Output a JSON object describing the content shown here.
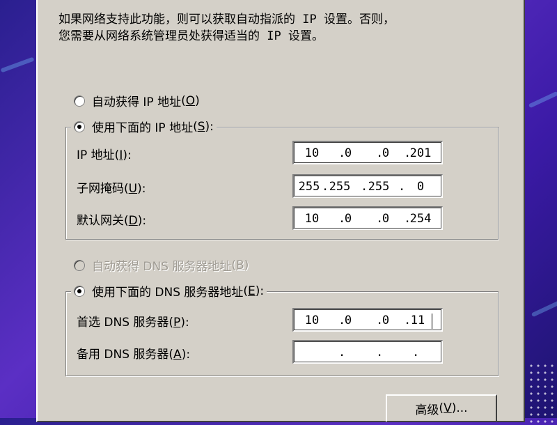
{
  "description": {
    "line1": "如果网络支持此功能，则可以获取自动指派的 IP 设置。否则，",
    "line2": "您需要从网络系统管理员处获得适当的 IP 设置。"
  },
  "ip_auto": {
    "label": "自动获得 IP 地址",
    "key": "O",
    "checked": false
  },
  "ip_manual": {
    "label": "使用下面的 IP 地址",
    "key": "S",
    "checked": true
  },
  "ip_fields": [
    {
      "label": "IP 地址",
      "key": "I",
      "octets": [
        "10",
        "0",
        "0",
        "201"
      ]
    },
    {
      "label": "子网掩码",
      "key": "U",
      "octets": [
        "255",
        "255",
        "255",
        "0"
      ]
    },
    {
      "label": "默认网关",
      "key": "D",
      "octets": [
        "10",
        "0",
        "0",
        "254"
      ]
    }
  ],
  "dns_auto": {
    "label": "自动获得 DNS 服务器地址",
    "key": "B",
    "checked": false,
    "disabled": true
  },
  "dns_manual": {
    "label": "使用下面的 DNS 服务器地址",
    "key": "E",
    "checked": true
  },
  "dns_fields": [
    {
      "label": "首选 DNS 服务器",
      "key": "P",
      "octets": [
        "10",
        "0",
        "0",
        "11"
      ]
    },
    {
      "label": "备用 DNS 服务器",
      "key": "A",
      "octets": [
        "",
        "",
        "",
        ""
      ]
    }
  ],
  "advanced_button": {
    "label": "高级",
    "key": "V",
    "suffix": "..."
  },
  "colors": {
    "dialog_bg": "#d4d0c8",
    "desktop": "#4a2ab8",
    "disabled_text": "#a09c94"
  }
}
